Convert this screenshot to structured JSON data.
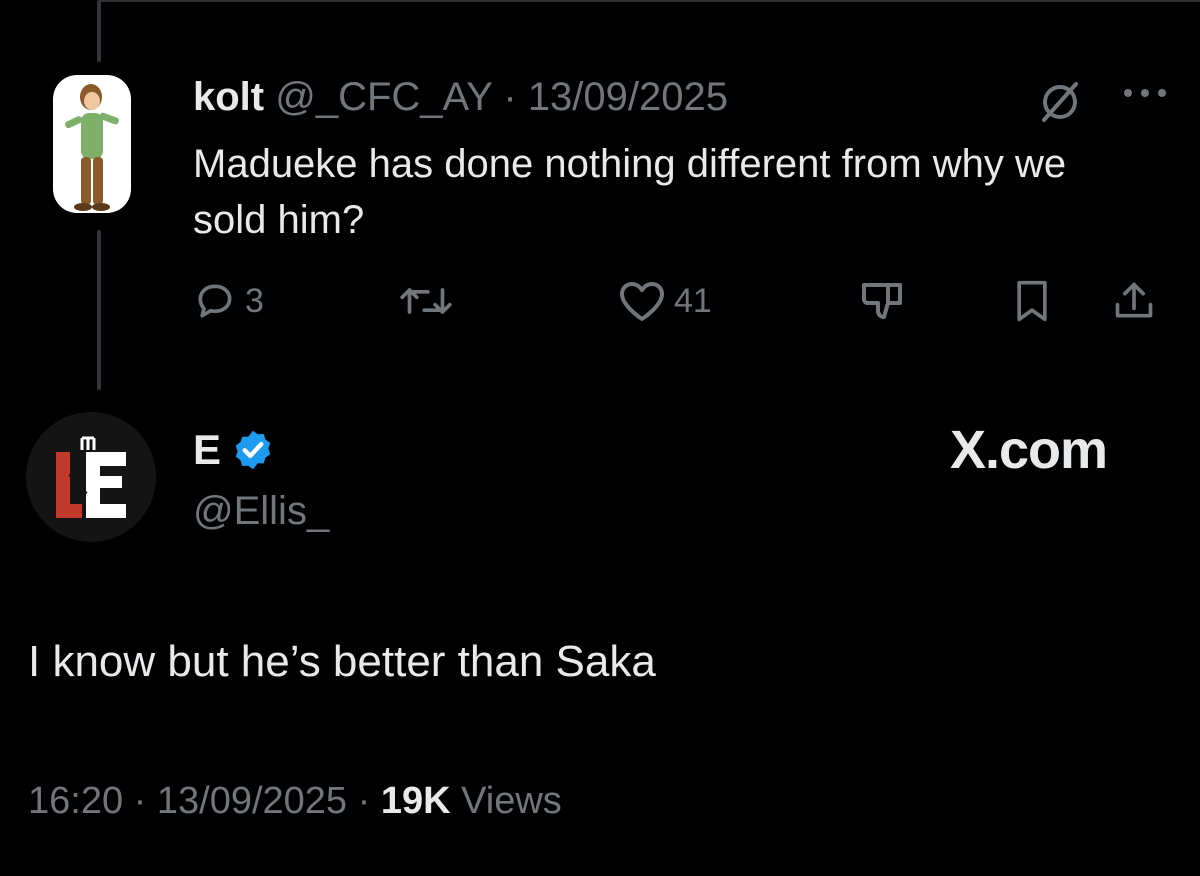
{
  "reply_tweet": {
    "display_name": "kolt",
    "handle": "@_CFC_AY",
    "separator": "·",
    "date": "13/09/2025",
    "text": "Madueke has done nothing different from why we sold him?",
    "actions": {
      "reply_count": "3",
      "repost_count": "",
      "like_count": "41"
    },
    "avatar_icon": "cartoon-character-avatar"
  },
  "main_tweet": {
    "display_name": "E",
    "verified": true,
    "handle": "@Ellis_",
    "text": "I know but he’s better than Saka",
    "time": "16:20",
    "separator": "·",
    "date": "13/09/2025",
    "views_count": "19K",
    "views_label": "Views",
    "avatar_icon": "ue-logo-avatar"
  },
  "watermark": "X.com",
  "colors": {
    "background": "#000000",
    "text": "#e7e9ea",
    "muted": "#71767b",
    "verified": "#1d9bf0",
    "logo_red": "#c0392b"
  }
}
